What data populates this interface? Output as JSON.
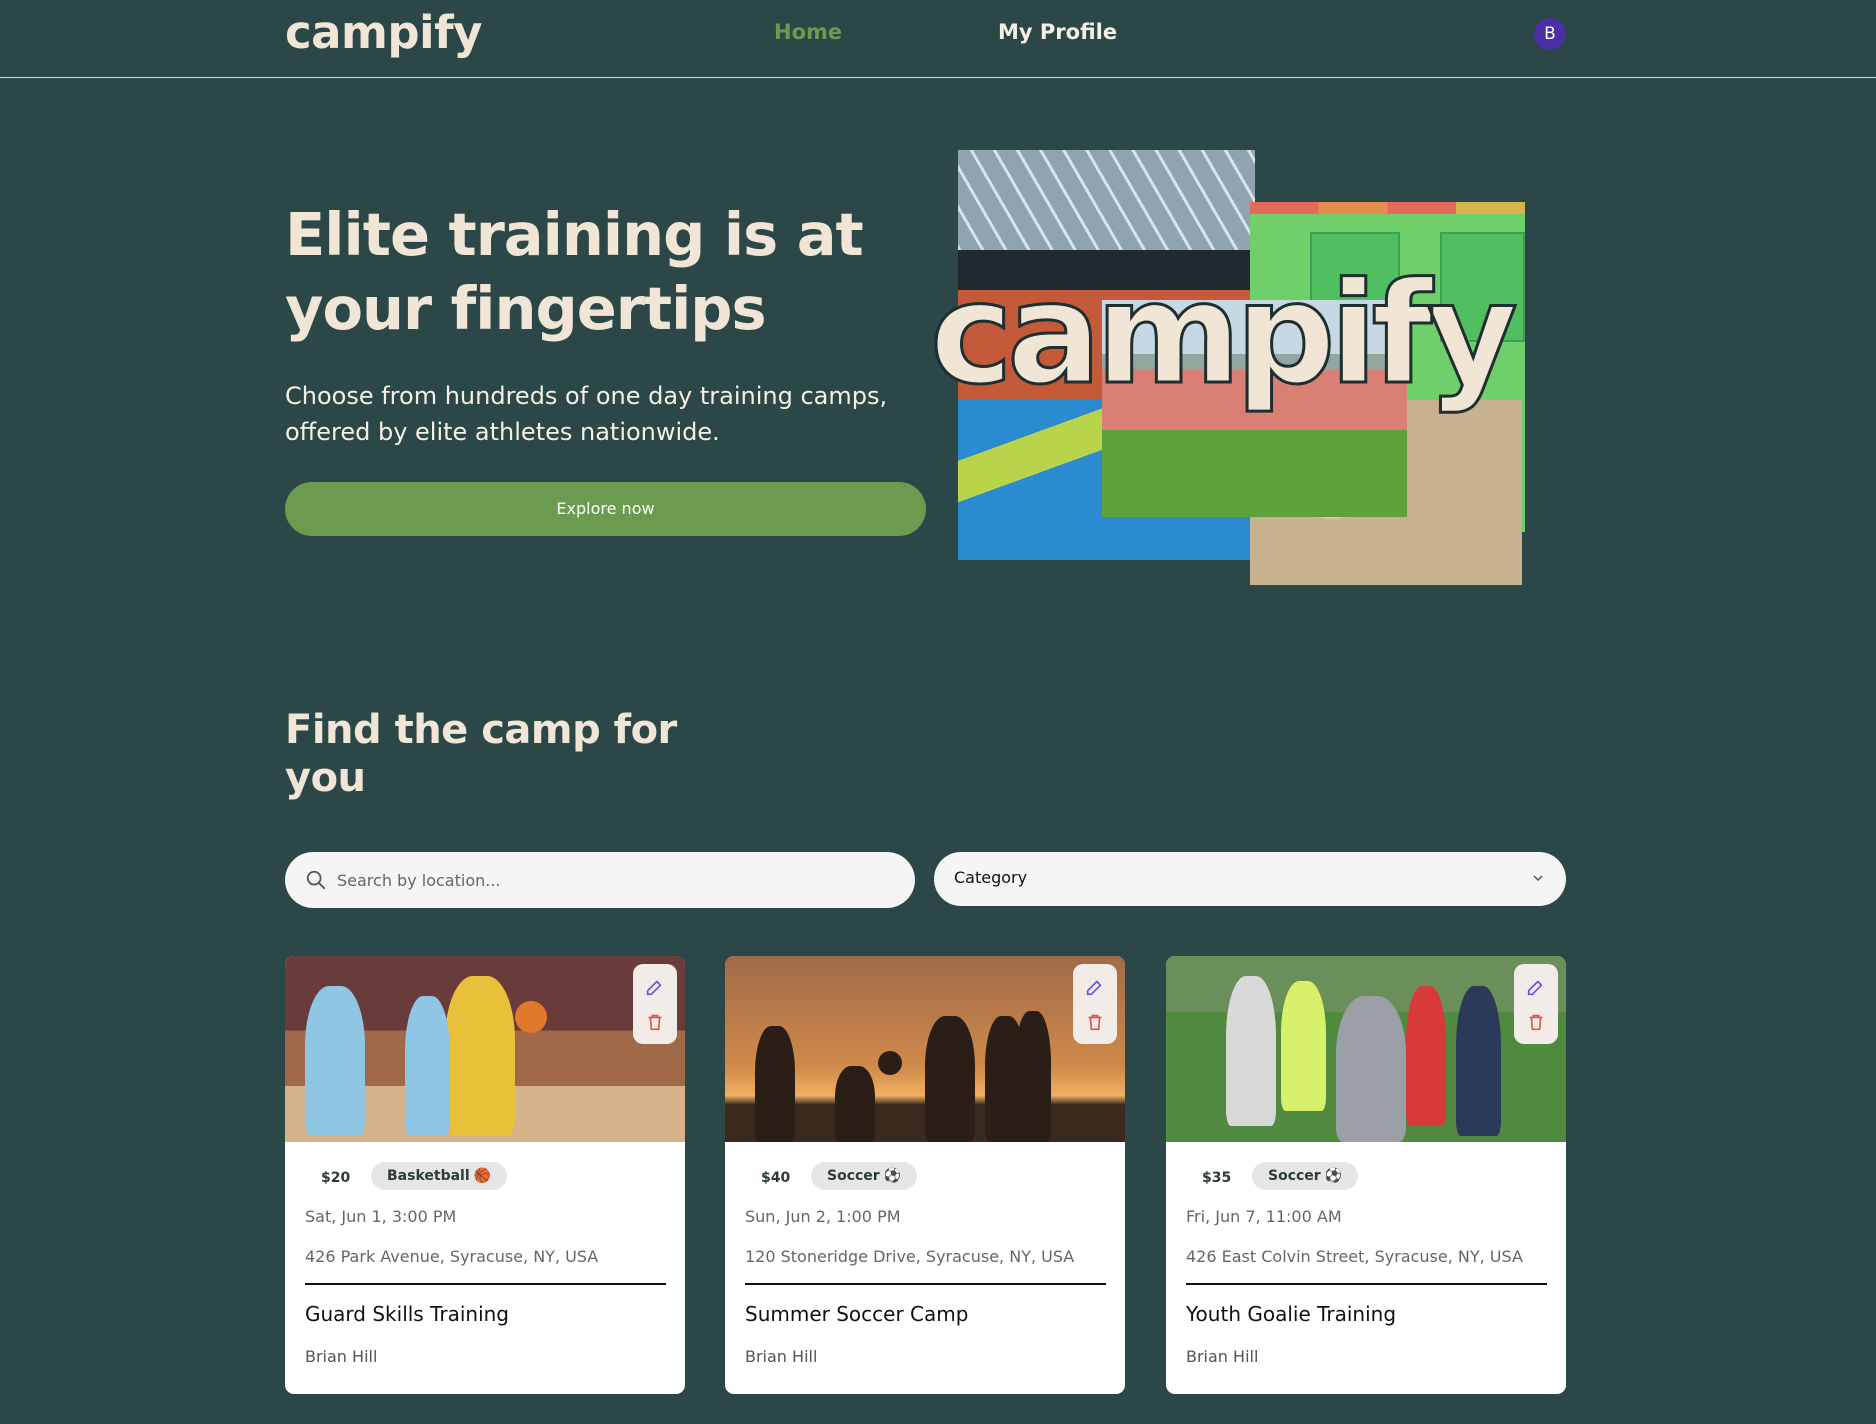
{
  "nav": {
    "logo": "campify",
    "links": [
      {
        "label": "Home",
        "active": true
      },
      {
        "label": "My Profile",
        "active": false
      }
    ],
    "avatar_initial": "B"
  },
  "hero": {
    "title": "Elite training is at your fingertips",
    "subtitle": "Choose from hundreds of one day training camps, offered by elite athletes nationwide.",
    "cta": "Explore now",
    "collage_word": "campify"
  },
  "find": {
    "title": "Find the camp for you",
    "search_placeholder": "Search by location...",
    "category_label": "Category"
  },
  "cards": [
    {
      "price": "$20",
      "category": "Basketball",
      "category_emoji": "🏀",
      "date": "Sat, Jun 1, 3:00 PM",
      "address": "426 Park Avenue, Syracuse, NY, USA",
      "title": "Guard Skills Training",
      "coach": "Brian Hill"
    },
    {
      "price": "$40",
      "category": "Soccer",
      "category_emoji": "⚽",
      "date": "Sun, Jun 2, 1:00 PM",
      "address": "120 Stoneridge Drive, Syracuse, NY, USA",
      "title": "Summer Soccer Camp",
      "coach": "Brian Hill"
    },
    {
      "price": "$35",
      "category": "Soccer",
      "category_emoji": "⚽",
      "date": "Fri, Jun 7, 11:00 AM",
      "address": "426 East Colvin Street, Syracuse, NY, USA",
      "title": "Youth Goalie Training",
      "coach": "Brian Hill"
    }
  ],
  "colors": {
    "background": "#2b4747",
    "accent_green": "#6a9b4e",
    "cream": "#f1e6d6",
    "avatar": "#4a2fa5"
  }
}
